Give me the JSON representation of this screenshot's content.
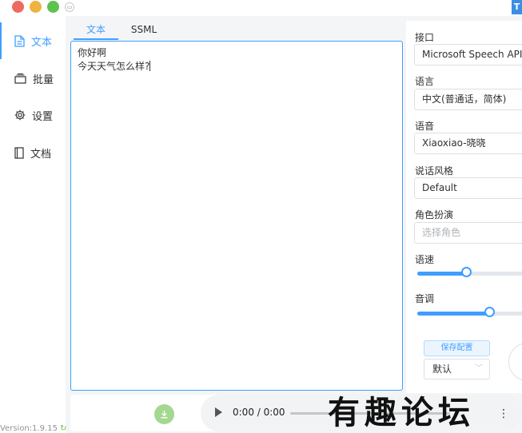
{
  "window": {
    "corner_badge": "T"
  },
  "sidebar": {
    "items": [
      {
        "label": "文本",
        "icon": "document-icon",
        "active": true
      },
      {
        "label": "批量",
        "icon": "stack-icon",
        "active": false
      },
      {
        "label": "设置",
        "icon": "gear-icon",
        "active": false
      },
      {
        "label": "文档",
        "icon": "book-icon",
        "active": false
      }
    ],
    "version": "Version:1.9.15"
  },
  "editor": {
    "tabs": [
      "文本",
      "SSML"
    ],
    "active_tab": "文本",
    "lines": [
      "你好啊",
      "今天天气怎么样?"
    ]
  },
  "player": {
    "time": "0:00 / 0:00"
  },
  "settings": {
    "api_label": "接口",
    "api_value": "Microsoft Speech API",
    "language_label": "语言",
    "language_value": "中文(普通话，简体)",
    "voice_label": "语音",
    "voice_value": "Xiaoxiao-晓晓",
    "style_label": "说话风格",
    "style_value": "Default",
    "role_label": "角色扮演",
    "role_placeholder": "选择角色",
    "rate_label": "语速",
    "rate_value": 0.45,
    "pitch_label": "音调",
    "pitch_value": 0.67,
    "save_label": "保存配置",
    "preset_value": "默认"
  },
  "watermark": "有趣论坛",
  "colors": {
    "accent": "#409eff",
    "download_button": "#a4d891"
  }
}
